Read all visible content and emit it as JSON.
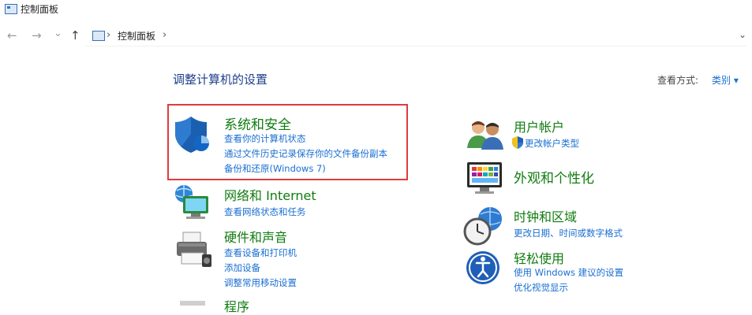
{
  "window": {
    "title": "控制面板"
  },
  "nav": {
    "back": "←",
    "forward": "→",
    "recent": "⌄",
    "up": "↑"
  },
  "address": {
    "separator": "›",
    "path": "控制面板",
    "dropdown": "⌄"
  },
  "header": {
    "title": "调整计算机的设置",
    "view_by_label": "查看方式:",
    "view_by_value": "类别 ▾"
  },
  "categories_left": [
    {
      "title": "系统和安全",
      "links": [
        "查看你的计算机状态",
        "通过文件历史记录保存你的文件备份副本",
        "备份和还原(Windows 7)"
      ],
      "icon": "shield-icon"
    },
    {
      "title": "网络和 Internet",
      "links": [
        "查看网络状态和任务"
      ],
      "icon": "network-icon"
    },
    {
      "title": "硬件和声音",
      "links": [
        "查看设备和打印机",
        "添加设备",
        "调整常用移动设置"
      ],
      "icon": "printer-icon"
    },
    {
      "title": "程序",
      "links": [],
      "icon": "programs-icon"
    }
  ],
  "categories_right": [
    {
      "title": "用户帐户",
      "links": [
        "更改帐户类型"
      ],
      "icon": "users-icon"
    },
    {
      "title": "外观和个性化",
      "links": [],
      "icon": "appearance-icon"
    },
    {
      "title": "时钟和区域",
      "links": [
        "更改日期、时间或数字格式"
      ],
      "icon": "clock-icon"
    },
    {
      "title": "轻松使用",
      "links": [
        "使用 Windows 建议的设置",
        "优化视觉显示"
      ],
      "icon": "ease-of-access-icon"
    }
  ],
  "colors": {
    "category_title": "#107c10",
    "link": "#1a6fd1",
    "heading": "#1e3f8c",
    "highlight_border": "#e03b3b"
  }
}
